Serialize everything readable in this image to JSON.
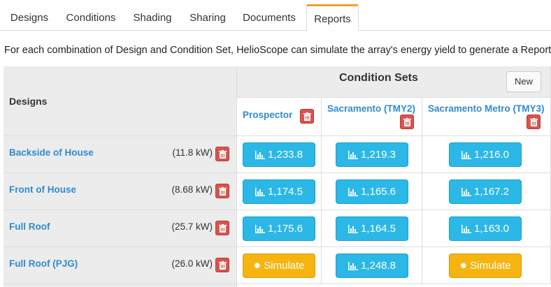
{
  "tabs": [
    {
      "label": "Designs",
      "active": false
    },
    {
      "label": "Conditions",
      "active": false
    },
    {
      "label": "Shading",
      "active": false
    },
    {
      "label": "Sharing",
      "active": false
    },
    {
      "label": "Documents",
      "active": false
    },
    {
      "label": "Reports",
      "active": true
    }
  ],
  "intro": "For each combination of Design and Condition Set, HelioScope can simulate the array's energy yield to generate a Report.",
  "table": {
    "designs_header": "Designs",
    "condition_sets_header": "Condition Sets",
    "new_label": "New",
    "condition_sets": [
      {
        "name": "Prospector"
      },
      {
        "name": "Sacramento (TMY2)"
      },
      {
        "name": "Sacramento Metro (TMY3)"
      }
    ],
    "rows": [
      {
        "design": "Backside of House",
        "kw": "(11.8 kW)",
        "cells": [
          {
            "type": "report",
            "label": "1,233.8"
          },
          {
            "type": "report",
            "label": "1,219.3"
          },
          {
            "type": "report",
            "label": "1,216.0"
          }
        ]
      },
      {
        "design": "Front of House",
        "kw": "(8.68 kW)",
        "cells": [
          {
            "type": "report",
            "label": "1,174.5"
          },
          {
            "type": "report",
            "label": "1,165.6"
          },
          {
            "type": "report",
            "label": "1,167.2"
          }
        ]
      },
      {
        "design": "Full Roof",
        "kw": "(25.7 kW)",
        "cells": [
          {
            "type": "report",
            "label": "1,175.6"
          },
          {
            "type": "report",
            "label": "1,164.5"
          },
          {
            "type": "report",
            "label": "1,163.0"
          }
        ]
      },
      {
        "design": "Full Roof (PJG)",
        "kw": "(26.0 kW)",
        "cells": [
          {
            "type": "simulate",
            "label": "Simulate"
          },
          {
            "type": "report",
            "label": "1,248.8"
          },
          {
            "type": "simulate",
            "label": "Simulate"
          }
        ]
      }
    ]
  },
  "colors": {
    "link": "#2f8bd0",
    "report_button": "#2bb8e6",
    "simulate_button": "#f5b40f",
    "delete_button": "#d9534f",
    "active_tab_accent": "#f0a030"
  },
  "icons": {
    "report": "bar-chart-icon",
    "simulate": "gear-icon",
    "delete": "trash-icon"
  }
}
